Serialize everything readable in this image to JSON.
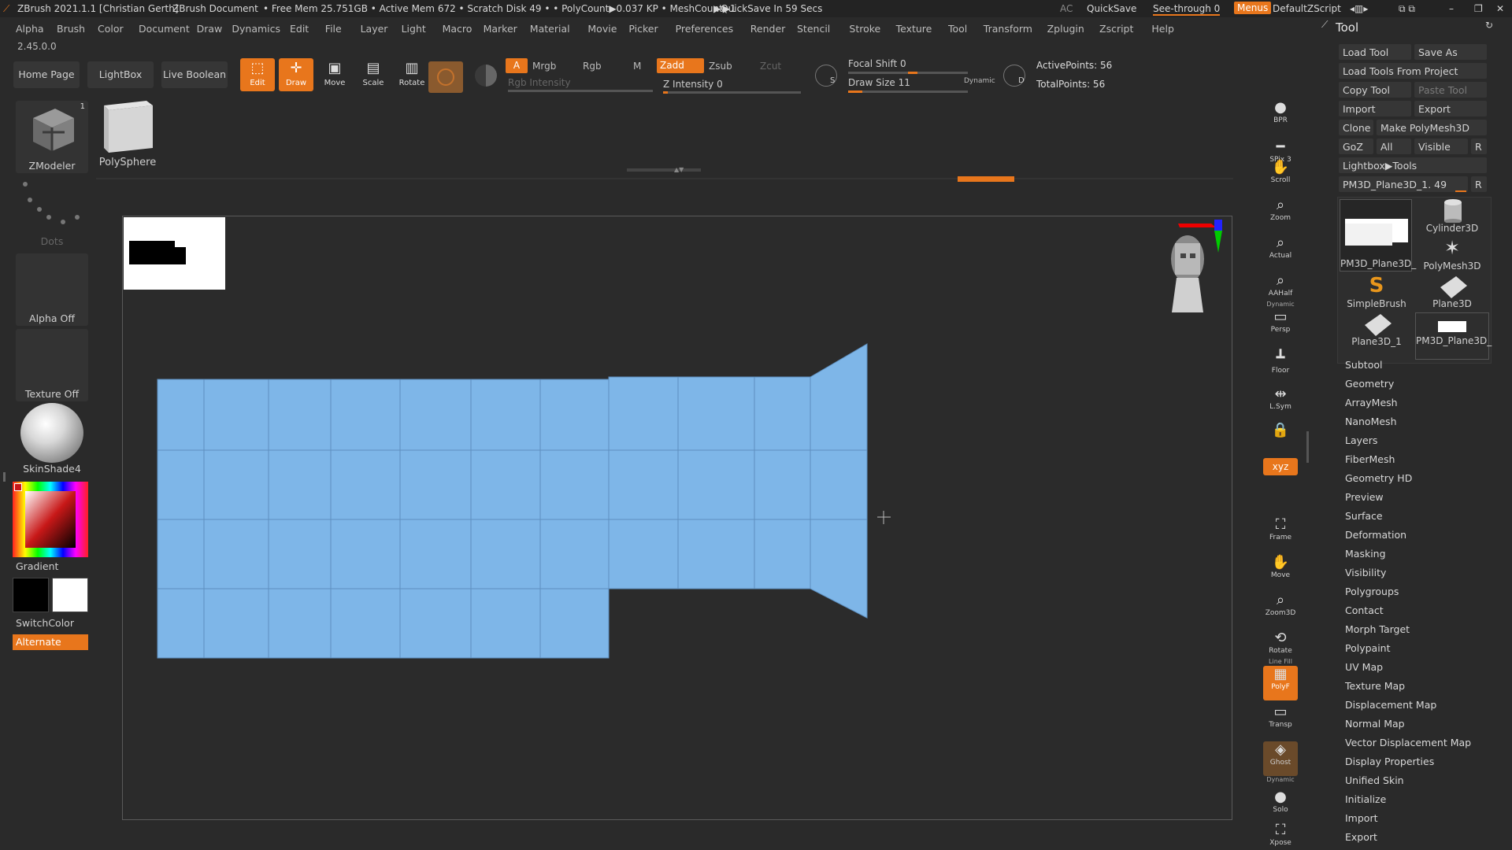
{
  "titlebar": {
    "app_title": "ZBrush 2021.1.1 [Christian Gerth]",
    "document": "ZBrush Document",
    "stats": "• Free Mem 25.751GB • Active Mem 672 • Scratch Disk 49 • • PolyCount▶0.037 KP • MeshCount▶1",
    "quicksave_status": "▶QuickSave In 59 Secs",
    "ac": "AC",
    "quicksave": "QuickSave",
    "see_through": "See-through 0",
    "menus": "Menus",
    "script": "DefaultZScript",
    "accent": "#e8761c"
  },
  "menubar": [
    "Alpha",
    "Brush",
    "Color",
    "Document",
    "Draw",
    "Dynamics",
    "Edit",
    "File",
    "Layer",
    "Light",
    "Macro",
    "Marker",
    "Material",
    "Movie",
    "Picker",
    "Preferences",
    "Render",
    "Stencil",
    "Stroke",
    "Texture",
    "Tool",
    "Transform",
    "Zplugin",
    "Zscript",
    "Help"
  ],
  "version": "2.45.0.0",
  "shelf": {
    "home_page": "Home Page",
    "lightbox": "LightBox",
    "live_boolean": "Live Boolean",
    "edit": "Edit",
    "draw": "Draw",
    "move": "Move",
    "scale": "Scale",
    "rotate": "Rotate",
    "a": "A",
    "mrgb": "Mrgb",
    "rgb": "Rgb",
    "m": "M",
    "zadd": "Zadd",
    "zsub": "Zsub",
    "zcut": "Zcut",
    "rgb_intensity": "Rgb Intensity",
    "z_intensity": "Z Intensity 0",
    "focal_shift": "Focal Shift 0",
    "draw_size": "Draw Size 11",
    "dynamic": "Dynamic",
    "active_points": "ActivePoints: 56",
    "total_points": "TotalPoints: 56",
    "focal_shift_level": 0.5,
    "draw_size_level": 0.12,
    "z_intensity_level": 0.0
  },
  "left_tray": {
    "brush_label": "ZModeler",
    "brush_badge": "1",
    "tool_label": "PolySphere",
    "stroke_label": "Dots",
    "alpha_label": "Alpha Off",
    "texture_label": "Texture Off",
    "material_label": "SkinShade4",
    "gradient_label": "Gradient",
    "switchcolor_label": "SwitchColor",
    "alternate_label": "Alternate"
  },
  "right_shelf": [
    {
      "icon": "bpr-icon",
      "label": "BPR"
    },
    {
      "icon": "spix-icon",
      "label": "SPix 3"
    },
    {
      "icon": "scroll-icon",
      "label": "Scroll"
    },
    {
      "icon": "zoom-icon",
      "label": "Zoom"
    },
    {
      "icon": "actual-icon",
      "label": "Actual"
    },
    {
      "icon": "aahalf-icon",
      "label": "AAHalf"
    },
    {
      "icon": "persp-icon",
      "label": "Persp"
    },
    {
      "icon": "floor-icon",
      "label": "Floor"
    },
    {
      "icon": "lsym-icon",
      "label": "L.Sym"
    },
    {
      "icon": "lock-icon",
      "label": ""
    },
    {
      "icon": "xyz-icon",
      "label": "Qxyz"
    },
    {
      "icon": "frame-icon",
      "label": "Frame"
    },
    {
      "icon": "move-icon",
      "label": "Move"
    },
    {
      "icon": "zoom3d-icon",
      "label": "Zoom3D"
    },
    {
      "icon": "rotate-icon",
      "label": "Rotate"
    },
    {
      "icon": "polyf-icon",
      "label": "PolyF"
    },
    {
      "icon": "transp-icon",
      "label": "Transp"
    },
    {
      "icon": "ghost-icon",
      "label": "Ghost"
    },
    {
      "icon": "solo-icon",
      "label": "Solo"
    },
    {
      "icon": "xpose-icon",
      "label": "Xpose"
    }
  ],
  "right_shelf_extra": {
    "dynamic_label": "Dynamic",
    "line_fill": "Line Fill",
    "dynamic2": "Dynamic"
  },
  "tool_panel": {
    "title": "Tool",
    "load_tool": "Load Tool",
    "save_as": "Save As",
    "load_from_project": "Load Tools From Project",
    "copy_tool": "Copy Tool",
    "paste_tool": "Paste Tool",
    "import": "Import",
    "export": "Export",
    "clone": "Clone",
    "make_polymesh": "Make PolyMesh3D",
    "goz": "GoZ",
    "all": "All",
    "visible": "Visible",
    "r": "R",
    "lightbox_tools": "Lightbox▶Tools",
    "current_tool": "PM3D_Plane3D_1. 49",
    "thumbnails": [
      "PM3D_Plane3D_",
      "Cylinder3D",
      "PolyMesh3D",
      "SimpleBrush",
      "Plane3D",
      "Plane3D_1",
      "PM3D_Plane3D_"
    ],
    "sections": [
      "Subtool",
      "Geometry",
      "ArrayMesh",
      "NanoMesh",
      "Layers",
      "FiberMesh",
      "Geometry HD",
      "Preview",
      "Surface",
      "Deformation",
      "Masking",
      "Visibility",
      "Polygroups",
      "Contact",
      "Morph Target",
      "Polypaint",
      "UV Map",
      "Texture Map",
      "Displacement Map",
      "Normal Map",
      "Vector Displacement Map",
      "Display Properties",
      "Unified Skin",
      "Initialize",
      "Import",
      "Export"
    ]
  },
  "mesh_color": "#7eb6e8"
}
